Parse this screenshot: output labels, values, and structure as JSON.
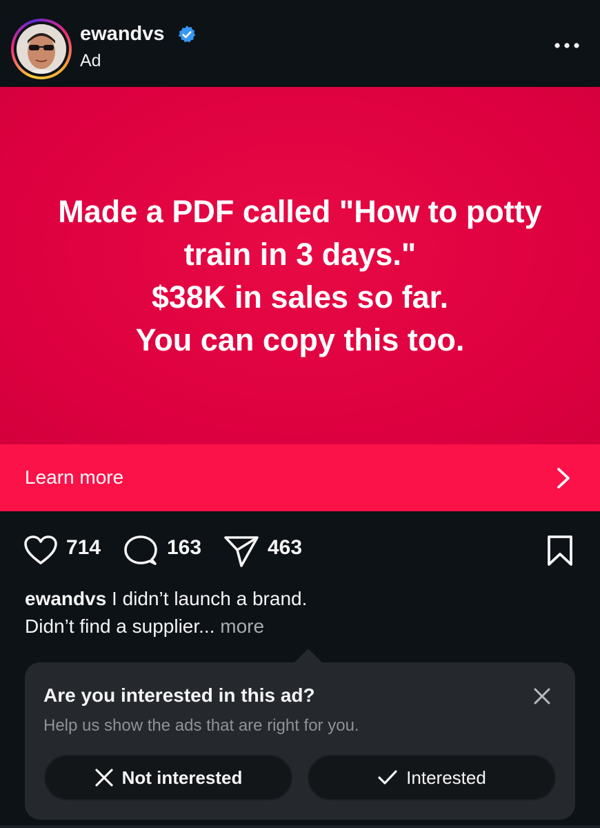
{
  "header": {
    "username": "ewandvs",
    "subtitle": "Ad",
    "verified_icon": "verified-badge-icon",
    "options_icon": "more-options-icon"
  },
  "creative": {
    "headline": "Made a PDF called \"How to potty\ntrain in 3 days.\"\n$38K in sales so far.\nYou can copy this too.",
    "background_color": "#dd0040"
  },
  "cta": {
    "label": "Learn more",
    "color": "#fb1249",
    "icon": "chevron-right-icon"
  },
  "actions": {
    "likes": "714",
    "comments": "163",
    "shares": "463",
    "icons": [
      "heart-icon",
      "comment-icon",
      "send-icon",
      "bookmark-icon"
    ]
  },
  "caption": {
    "username": "ewandvs",
    "line1": " I didn’t launch a brand.",
    "line2": "Didn’t find a supplier...",
    "more": "more"
  },
  "feedback": {
    "title": "Are you interested in this ad?",
    "subtitle": "Help us show the ads that are right for you.",
    "not_interested": "Not interested",
    "interested": "Interested"
  }
}
